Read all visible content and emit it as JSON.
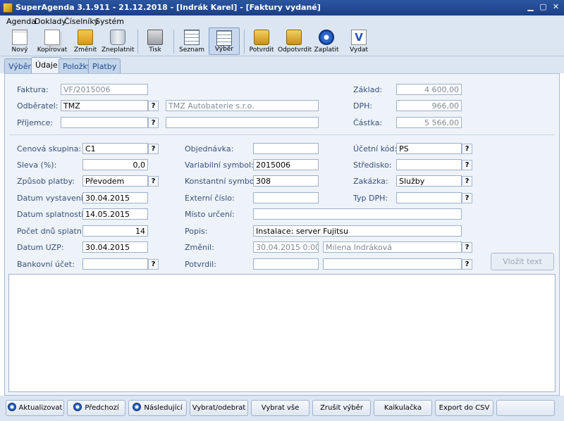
{
  "window": {
    "title": "SuperAgenda 3.1.911 - 21.12.2018 - [Indrák Karel] - [Faktury vydané]"
  },
  "menu": [
    "Agenda",
    "Doklady",
    "Číselníky",
    "Systém"
  ],
  "toolbar": {
    "buttons": [
      {
        "label": "Nový",
        "icon": "new-document-icon"
      },
      {
        "label": "Kopírovat",
        "icon": "copy-icon"
      },
      {
        "label": "Změnit",
        "icon": "edit-folder-icon"
      },
      {
        "label": "Zneplatnit",
        "icon": "recycle-bin-icon"
      },
      {
        "label": "Tisk",
        "icon": "printer-icon"
      },
      {
        "label": "Seznam",
        "icon": "list-grid-icon"
      },
      {
        "label": "Výběr",
        "icon": "select-grid-icon"
      },
      {
        "label": "Potvrdit",
        "icon": "lock-icon"
      },
      {
        "label": "Odpotvrdit",
        "icon": "unlock-icon"
      },
      {
        "label": "Zaplatit",
        "icon": "pay-disc-icon"
      },
      {
        "label": "Vydat",
        "icon": "issue-v-icon"
      }
    ]
  },
  "tabs": [
    "Výběr",
    "Údaje",
    "Položky",
    "Platby"
  ],
  "form": {
    "faktura": {
      "label": "Faktura:",
      "value": "VF/2015006"
    },
    "odberatel": {
      "label": "Odběratel:",
      "code": "TMZ",
      "name": "TMZ Autobaterie s.r.o."
    },
    "prijemce": {
      "label": "Příjemce:",
      "code": "",
      "name": ""
    },
    "zaklad": {
      "label": "Základ:",
      "value": "4 600,00"
    },
    "dph": {
      "label": "DPH:",
      "value": "966,00"
    },
    "castka": {
      "label": "Částka:",
      "value": "5 566,00"
    },
    "cenova_skupina": {
      "label": "Cenová skupina:",
      "value": "C1"
    },
    "sleva": {
      "label": "Sleva (%):",
      "value": "0,0"
    },
    "zpusob_platby": {
      "label": "Způsob platby:",
      "value": "Převodem"
    },
    "datum_vystaveni": {
      "label": "Datum vystavení:",
      "value": "30.04.2015"
    },
    "datum_splatnosti": {
      "label": "Datum splatnosti:",
      "value": "14.05.2015"
    },
    "pocet_dnu": {
      "label": "Počet dnů splatn.:",
      "value": "14"
    },
    "datum_uzp": {
      "label": "Datum UZP:",
      "value": "30.04.2015"
    },
    "bankovni_ucet": {
      "label": "Bankovní účet:",
      "value": ""
    },
    "objednavka": {
      "label": "Objednávka:",
      "value": ""
    },
    "variabilni_symbol": {
      "label": "Variabilní symbol:",
      "value": "2015006"
    },
    "konstantni_symbol": {
      "label": "Konstantní symbol:",
      "value": "308"
    },
    "externi_cislo": {
      "label": "Externí číslo:",
      "value": ""
    },
    "misto_urceni": {
      "label": "Místo určení:",
      "value": ""
    },
    "popis": {
      "label": "Popis:",
      "value": "Instalace: server Fujitsu"
    },
    "zmenil": {
      "label": "Změnil:",
      "date": "30.04.2015 0:00",
      "user": "Milena Indráková"
    },
    "potvrdil": {
      "label": "Potvrdil:",
      "date": "",
      "user": ""
    },
    "ucetni_kod": {
      "label": "Účetní kód:",
      "value": "PS"
    },
    "stredisko": {
      "label": "Středisko:",
      "value": ""
    },
    "zakazka": {
      "label": "Zakázka:",
      "value": "Služby"
    },
    "typ_dph": {
      "label": "Typ DPH:",
      "value": ""
    },
    "lookup_mark": "?",
    "vlozit_text": "Vložit text"
  },
  "bottom": {
    "buttons": [
      "Aktualizovat",
      "Předchozí",
      "Následující",
      "Vybrat/odebrat",
      "Vybrat vše",
      "Zrušit výběr",
      "Kalkulačka",
      "Export do CSV"
    ]
  }
}
